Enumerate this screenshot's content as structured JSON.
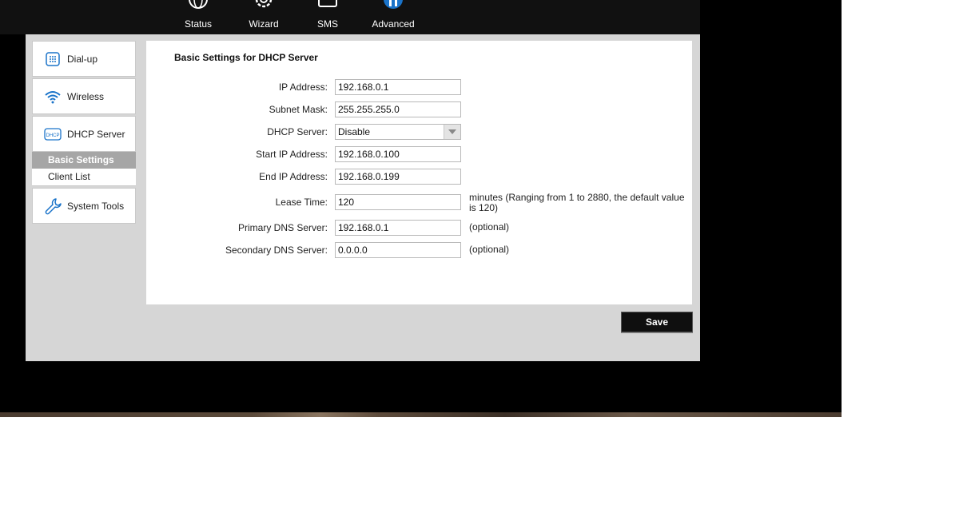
{
  "nav": [
    {
      "label": "Status",
      "icon": "globe-icon"
    },
    {
      "label": "Wizard",
      "icon": "gear-icon"
    },
    {
      "label": "SMS",
      "icon": "envelope-icon"
    },
    {
      "label": "Advanced",
      "icon": "advanced-icon"
    }
  ],
  "sidebar": {
    "items": [
      {
        "label": "Dial-up",
        "icon": "dialpad-icon"
      },
      {
        "label": "Wireless",
        "icon": "wifi-icon"
      },
      {
        "label": "DHCP Server",
        "icon": "dhcp-icon"
      }
    ],
    "subitems": [
      {
        "label": "Basic Settings",
        "active": true
      },
      {
        "label": "Client List",
        "active": false
      }
    ],
    "system_tools": {
      "label": "System Tools",
      "icon": "wrench-icon"
    }
  },
  "form": {
    "title": "Basic Settings for DHCP Server",
    "ip_address": {
      "label": "IP Address:",
      "value": "192.168.0.1"
    },
    "subnet_mask": {
      "label": "Subnet Mask:",
      "value": "255.255.255.0"
    },
    "dhcp_server": {
      "label": "DHCP Server:",
      "value": "Disable"
    },
    "start_ip": {
      "label": "Start IP Address:",
      "value": "192.168.0.100"
    },
    "end_ip": {
      "label": "End IP Address:",
      "value": "192.168.0.199"
    },
    "lease_time": {
      "label": "Lease Time:",
      "value": "120",
      "hint": "minutes (Ranging from 1 to 2880, the default value is 120)"
    },
    "primary_dns": {
      "label": "Primary DNS Server:",
      "value": "192.168.0.1",
      "hint": "(optional)"
    },
    "secondary_dns": {
      "label": "Secondary DNS Server:",
      "value": "0.0.0.0",
      "hint": "(optional)"
    },
    "save_label": "Save"
  },
  "colors": {
    "accent": "#1a73c9",
    "active_sub": "#a6a6a6",
    "panel_bg": "#d6d6d6"
  }
}
